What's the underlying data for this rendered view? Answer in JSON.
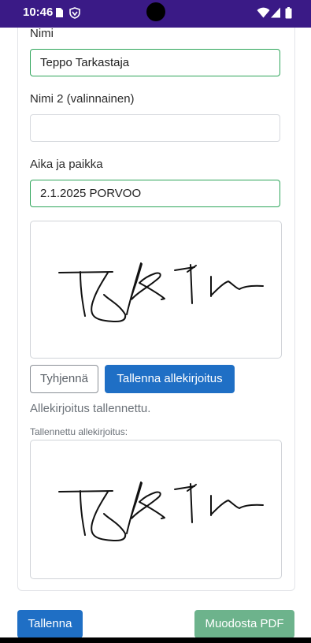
{
  "status_bar": {
    "time": "10:46",
    "icons": [
      "sim-card-icon",
      "shield-icon",
      "wifi-icon",
      "signal-icon",
      "battery-icon"
    ]
  },
  "form": {
    "name_label": "Nimi",
    "name_value": "Teppo Tarkastaja",
    "name2_label": "Nimi 2 (valinnainen)",
    "name2_value": "",
    "place_label": "Aika ja paikka",
    "place_value": "2.1.2025 PORVOO"
  },
  "signature": {
    "clear_label": "Tyhjennä",
    "save_label": "Tallenna allekirjoitus",
    "status_message": "Allekirjoitus tallennettu.",
    "saved_label": "Tallennettu allekirjoitus:"
  },
  "footer": {
    "save_label": "Tallenna",
    "pdf_label": "Muodosta PDF"
  },
  "colors": {
    "status_bar": "#3a1a86",
    "primary": "#1f6fc5",
    "success_border": "#2ea55a",
    "pdf_button": "#6db38c"
  }
}
